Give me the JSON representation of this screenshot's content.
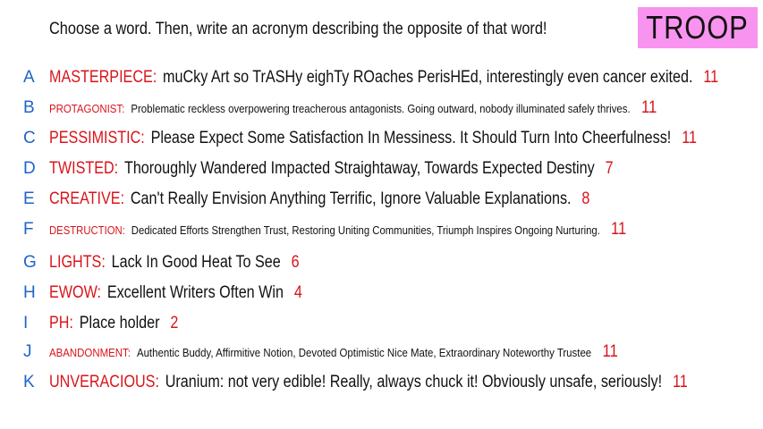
{
  "header": {
    "prompt": "Choose a word. Then, write an acronym describing the opposite of that word!",
    "team": "TROOP"
  },
  "colors": {
    "team_bg": "#f893f0",
    "letter": "#1f64c8",
    "word": "#d9141b",
    "count": "#d9141b",
    "text": "#111111"
  },
  "rows": [
    {
      "letter": "A",
      "word": "MASTERPIECE:",
      "desc": "muCky Art so TrASHy eighTy ROaches PerisHEd, interestingly even cancer exited.",
      "count": "11"
    },
    {
      "letter": "B",
      "word": "PROTAGONIST:",
      "desc": "Problematic reckless overpowering treacherous antagonists. Going outward, nobody illuminated safely thrives.",
      "count": "11"
    },
    {
      "letter": "C",
      "word": "PESSIMISTIC:",
      "desc": "Please Expect Some Satisfaction In Messiness. It Should Turn Into Cheerfulness!",
      "count": "11"
    },
    {
      "letter": "D",
      "word": "TWISTED:",
      "desc": "Thoroughly Wandered Impacted Straightaway, Towards Expected Destiny",
      "count": "7"
    },
    {
      "letter": "E",
      "word": "CREATIVE:",
      "desc": "Can't Really Envision Anything Terrific, Ignore Valuable Explanations.",
      "count": "8"
    },
    {
      "letter": "F",
      "word": "DESTRUCTION:",
      "desc": "Dedicated Efforts Strengthen Trust, Restoring Uniting Communities, Triumph Inspires Ongoing Nurturing.",
      "count": "11"
    },
    {
      "letter": "G",
      "word": "LIGHTS:",
      "desc": "Lack In Good Heat To See",
      "count": "6"
    },
    {
      "letter": "H",
      "word": "EWOW:",
      "desc": "Excellent Writers Often Win",
      "count": "4"
    },
    {
      "letter": "I",
      "word": "PH:",
      "desc": "Place holder",
      "count": "2"
    },
    {
      "letter": "J",
      "word": "ABANDONMENT:",
      "desc": "Authentic Buddy, Affirmitive Notion, Devoted Optimistic Nice Mate, Extraordinary Noteworthy Trustee",
      "count": "11"
    },
    {
      "letter": "K",
      "word": "UNVERACIOUS:",
      "desc": "Uranium: not very edible! Really, always chuck it! Obviously unsafe, seriously!",
      "count": "11"
    }
  ]
}
